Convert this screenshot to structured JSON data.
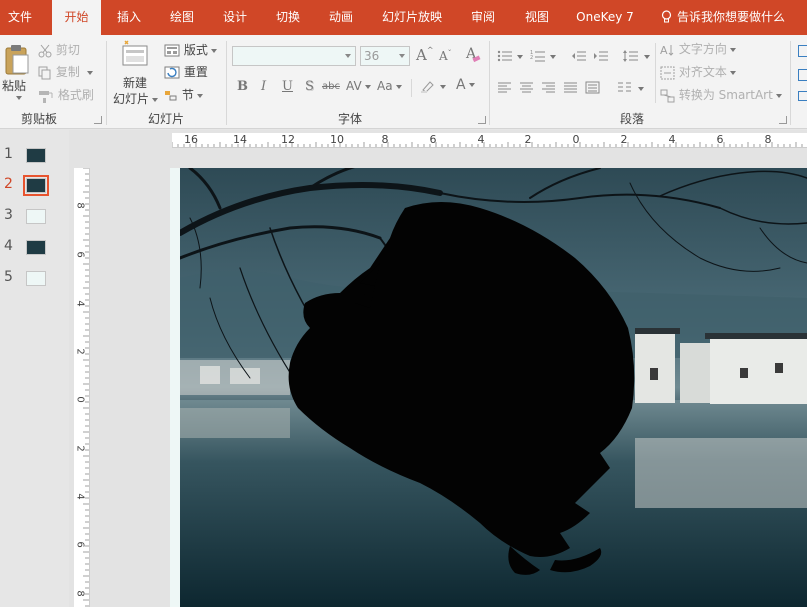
{
  "tabs": [
    {
      "label": "文件",
      "active": false
    },
    {
      "label": "开始",
      "active": true
    },
    {
      "label": "插入",
      "active": false
    },
    {
      "label": "绘图",
      "active": false
    },
    {
      "label": "设计",
      "active": false
    },
    {
      "label": "切换",
      "active": false
    },
    {
      "label": "动画",
      "active": false
    },
    {
      "label": "幻灯片放映",
      "active": false
    },
    {
      "label": "审阅",
      "active": false
    },
    {
      "label": "视图",
      "active": false
    },
    {
      "label": "OneKey 7",
      "active": false
    }
  ],
  "tell_me": "告诉我你想要做什么",
  "ribbon": {
    "clipboard": {
      "paste": "粘贴",
      "cut": "剪切",
      "copy": "复制",
      "format_painter": "格式刷",
      "group_label": "剪贴板"
    },
    "slides": {
      "new_slide_line1": "新建",
      "new_slide_line2": "幻灯片",
      "layout": "版式",
      "reset": "重置",
      "section": "节",
      "group_label": "幻灯片"
    },
    "font": {
      "font_name": "",
      "font_size": "36",
      "bold": "B",
      "italic": "I",
      "underline": "U",
      "shadow": "S",
      "strikethrough": "abc",
      "spacing": "AV",
      "case": "Aa",
      "grow": "A",
      "shrink": "A",
      "clear": "A",
      "color": "A",
      "group_label": "字体"
    },
    "paragraph": {
      "text_direction": "文字方向",
      "align_text": "对齐文本",
      "convert_smartart": "转换为 SmartArt",
      "group_label": "段落"
    }
  },
  "thumbnails": [
    {
      "number": "1",
      "style": "dark",
      "selected": false
    },
    {
      "number": "2",
      "style": "dark",
      "selected": true
    },
    {
      "number": "3",
      "style": "light",
      "selected": false
    },
    {
      "number": "4",
      "style": "dark",
      "selected": false
    },
    {
      "number": "5",
      "style": "light",
      "selected": false
    }
  ],
  "hruler_labels": [
    "16",
    "14",
    "12",
    "10",
    "8",
    "6",
    "4",
    "2",
    "0",
    "2",
    "4",
    "6",
    "8"
  ],
  "vruler_labels": [
    "8",
    "6",
    "4",
    "2",
    "0",
    "2",
    "4",
    "6",
    "8"
  ],
  "colors": {
    "accent": "#d04727",
    "ribbon_bg": "#f3f3f3",
    "pane_bg": "#e6e6e6",
    "selection": "#e8542f"
  }
}
